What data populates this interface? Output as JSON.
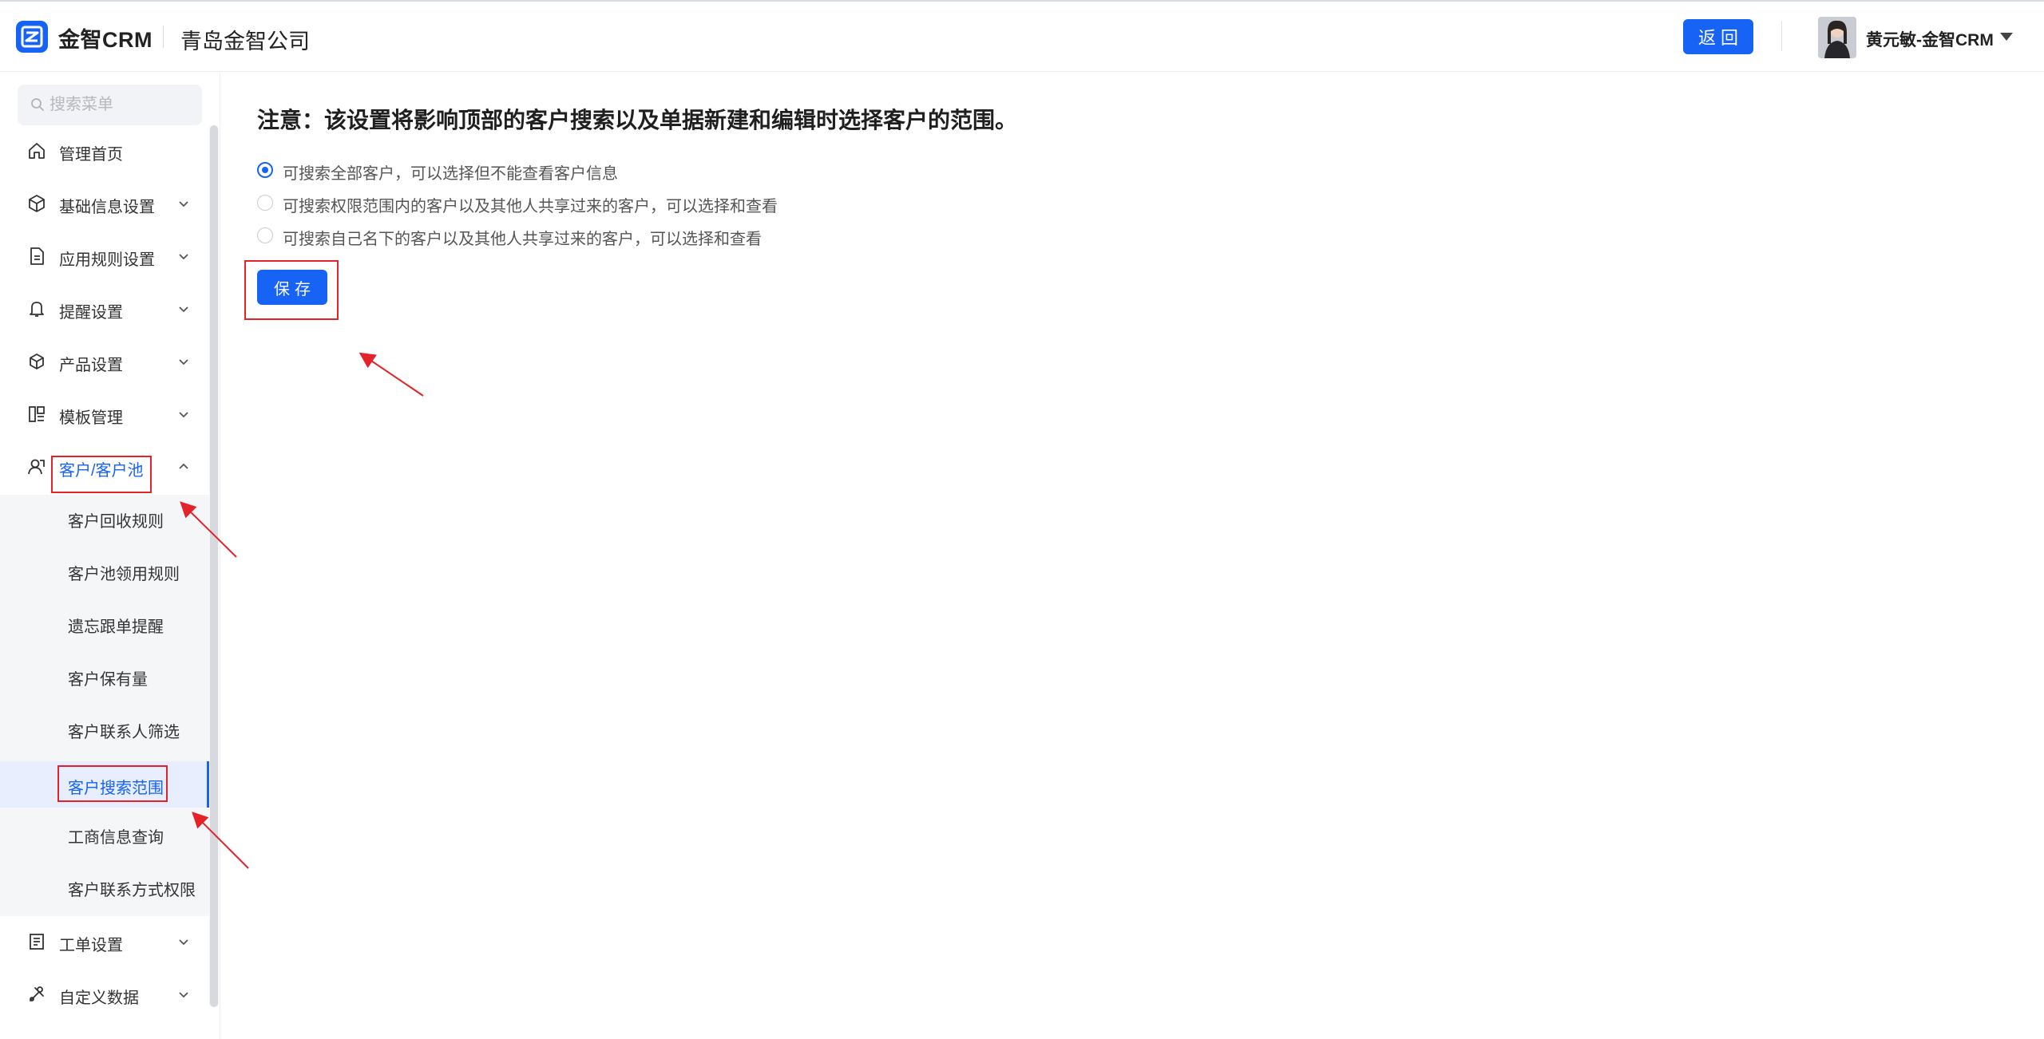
{
  "header": {
    "brand": "金智CRM",
    "company": "青岛金智公司",
    "back_label": "返回",
    "user_name": "黄元敏-金智CRM"
  },
  "sidebar": {
    "search_placeholder": "搜索菜单",
    "items": [
      {
        "label": "管理首页",
        "icon": "home-icon"
      },
      {
        "label": "基础信息设置",
        "icon": "cube-icon"
      },
      {
        "label": "应用规则设置",
        "icon": "document-icon"
      },
      {
        "label": "提醒设置",
        "icon": "bell-icon"
      },
      {
        "label": "产品设置",
        "icon": "box-icon"
      },
      {
        "label": "模板管理",
        "icon": "template-icon"
      },
      {
        "label": "客户/客户池",
        "icon": "customer-icon"
      },
      {
        "label": "工单设置",
        "icon": "workorder-icon"
      },
      {
        "label": "自定义数据",
        "icon": "tools-icon"
      }
    ],
    "submenu": [
      {
        "label": "客户回收规则"
      },
      {
        "label": "客户池领用规则"
      },
      {
        "label": "遗忘跟单提醒"
      },
      {
        "label": "客户保有量"
      },
      {
        "label": "客户联系人筛选"
      },
      {
        "label": "客户搜索范围",
        "active": true
      },
      {
        "label": "工商信息查询"
      },
      {
        "label": "客户联系方式权限"
      }
    ]
  },
  "main": {
    "notice": "注意：该设置将影响顶部的客户搜索以及单据新建和编辑时选择客户的范围。",
    "options": [
      {
        "label": "可搜索全部客户，可以选择但不能查看客户信息",
        "checked": true
      },
      {
        "label": "可搜索权限范围内的客户以及其他人共享过来的客户，可以选择和查看",
        "checked": false
      },
      {
        "label": "可搜索自己名下的客户以及其他人共享过来的客户，可以选择和查看",
        "checked": false
      }
    ],
    "save_label": "保存"
  },
  "colors": {
    "accent": "#1663f6",
    "annotation": "#e5222a"
  }
}
